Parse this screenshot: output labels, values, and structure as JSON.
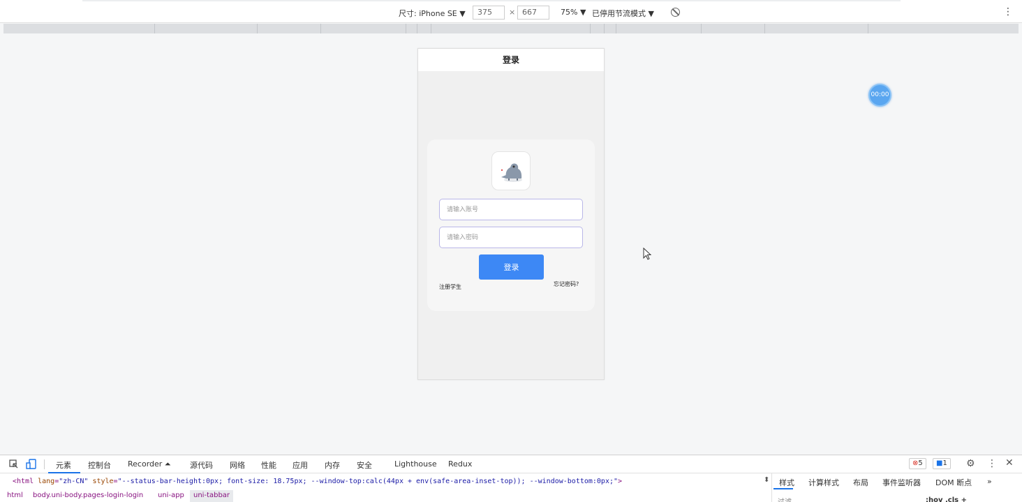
{
  "device_toolbar": {
    "size_label": "尺寸: iPhone SE ▼",
    "width": "375",
    "times": "×",
    "height": "667",
    "zoom": "75% ▼",
    "throttle": "已停用节流模式 ▼"
  },
  "app": {
    "nav_title": "登录",
    "account_placeholder": "请输入账号",
    "password_placeholder": "请输入密码",
    "login_button": "登录",
    "register_link": "注册学生",
    "forgot_link": "忘记密码?"
  },
  "timer": "00:00",
  "devtools": {
    "tabs": [
      "元素",
      "控制台",
      "Recorder ⏶",
      "源代码",
      "网络",
      "性能",
      "应用",
      "内存",
      "安全",
      "Lighthouse",
      "Redux"
    ],
    "errors": "5",
    "messages": "1",
    "code_tag_open": "<html ",
    "code_attr_lang": "lang",
    "code_val_lang": "\"zh-CN\"",
    "code_attr_style": "style",
    "code_val_style": "\"--status-bar-height:0px; font-size: 18.75px; --window-top:calc(44px + env(safe-area-inset-top)); --window-bottom:0px;\"",
    "code_tag_close": ">",
    "breadcrumbs": [
      "html",
      "body.uni-body.pages-login-login",
      "uni-app",
      "uni-tabbar"
    ],
    "side_tabs": [
      "样式",
      "计算样式",
      "布局",
      "事件监听器",
      "DOM 断点",
      "»"
    ],
    "filter_placeholder": "过滤",
    "side_tools": ":hov  .cls  +"
  }
}
